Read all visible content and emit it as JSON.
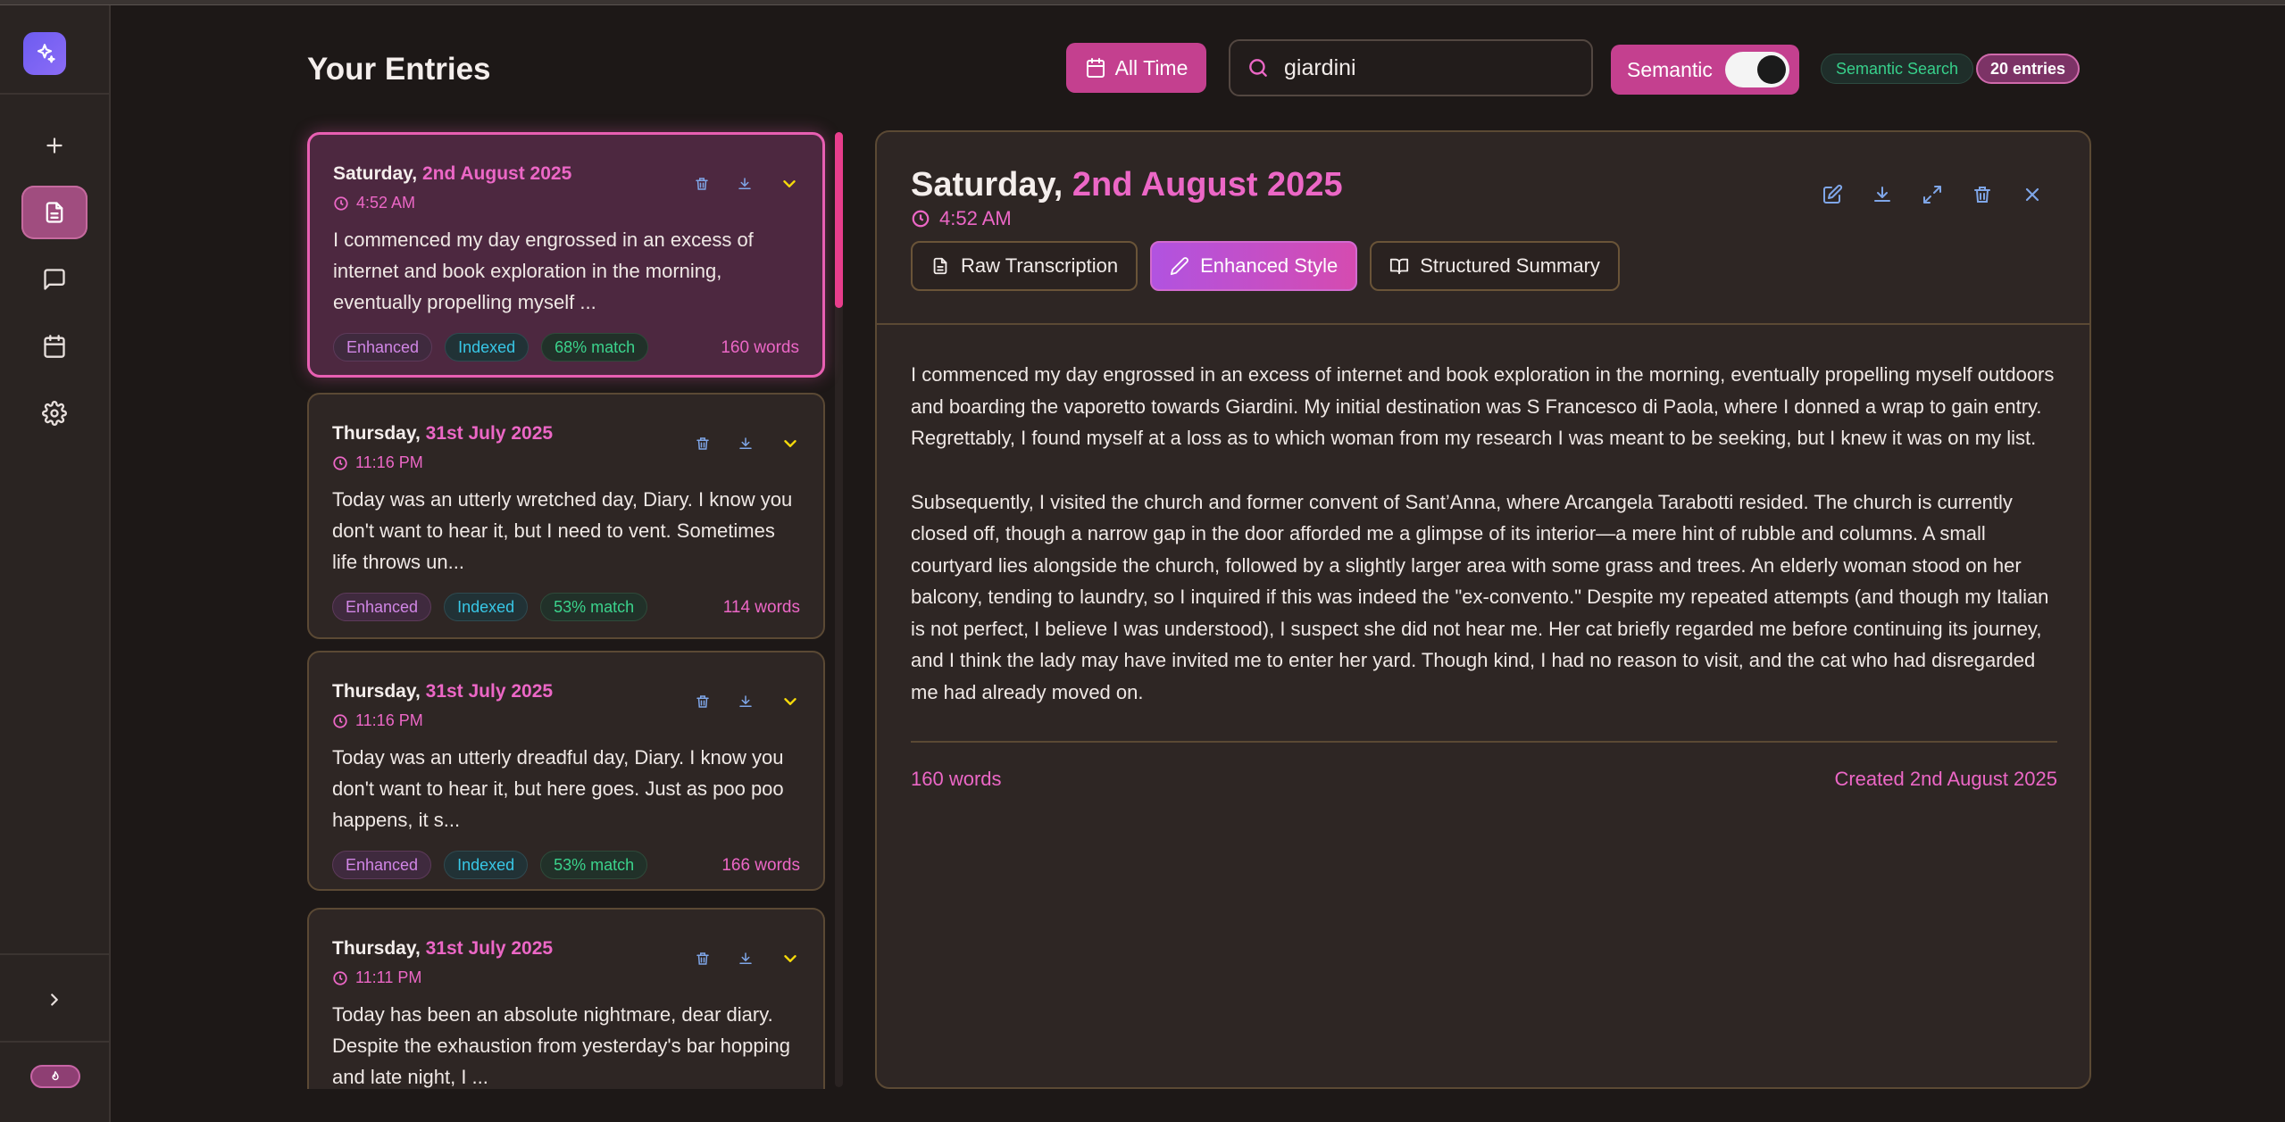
{
  "header": {
    "title": "Your Entries",
    "all_time_label": "All Time",
    "search_value": "giardini",
    "semantic_label": "Semantic",
    "semantic_enabled": true,
    "semantic_badge": "Semantic Search",
    "entries_count": "20 entries"
  },
  "sidebar": {
    "items": [
      {
        "icon": "plus-icon"
      },
      {
        "icon": "document-icon",
        "active": true
      },
      {
        "icon": "chat-icon"
      },
      {
        "icon": "calendar-icon"
      },
      {
        "icon": "gear-icon"
      }
    ],
    "expand_icon": "chevron-right-icon"
  },
  "entries": [
    {
      "weekday": "Saturday,",
      "date": "2nd August 2025",
      "time": "4:52 AM",
      "excerpt": "I commenced my day engrossed in an excess of internet and book exploration in the morning, eventually propelling myself ...",
      "tags": [
        "Enhanced",
        "Indexed",
        "68% match"
      ],
      "words": "160 words",
      "selected": true
    },
    {
      "weekday": "Thursday,",
      "date": "31st July 2025",
      "time": "11:16 PM",
      "excerpt": "Today was an utterly wretched day, Diary. I know you don't want to hear it, but I need to vent. Sometimes life throws un...",
      "tags": [
        "Enhanced",
        "Indexed",
        "53% match"
      ],
      "words": "114 words"
    },
    {
      "weekday": "Thursday,",
      "date": "31st July 2025",
      "time": "11:16 PM",
      "excerpt": "Today was an utterly dreadful day, Diary. I know you don't want to hear it, but here goes. Just as poo poo happens, it s...",
      "tags": [
        "Enhanced",
        "Indexed",
        "53% match"
      ],
      "words": "166 words"
    },
    {
      "weekday": "Thursday,",
      "date": "31st July 2025",
      "time": "11:11 PM",
      "excerpt": "Today has been an absolute nightmare, dear diary. Despite the exhaustion from yesterday's bar hopping and late night, I ...",
      "tags": [],
      "words": ""
    }
  ],
  "detail": {
    "weekday": "Saturday,",
    "date": "2nd August 2025",
    "time": "4:52 AM",
    "modes": [
      "Raw Transcription",
      "Enhanced Style",
      "Structured Summary"
    ],
    "active_mode": "Enhanced Style",
    "paragraphs": [
      "I commenced my day engrossed in an excess of internet and book exploration in the morning, eventually propelling myself outdoors and boarding the vaporetto towards Giardini. My initial destination was S Francesco di Paola, where I donned a wrap to gain entry. Regrettably, I found myself at a loss as to which woman from my research I was meant to be seeking, but I knew it was on my list.",
      "Subsequently, I visited the church and former convent of Sant’Anna, where Arcangela Tarabotti resided. The church is currently closed off, though a narrow gap in the door afforded me a glimpse of its interior—a mere hint of rubble and columns. A small courtyard lies alongside the church, followed by a slightly larger area with some grass and trees. An elderly woman stood on her balcony, tending to laundry, so I inquired if this was indeed the \"ex-convento.\" Despite my repeated attempts (and though my Italian is not perfect, I believe I was understood), I suspect she did not hear me. Her cat briefly regarded me before continuing its journey, and I think the lady may have invited me to enter her yard. Though kind, I had no reason to visit, and the cat who had disregarded me had already moved on."
    ],
    "words": "160 words",
    "created": "Created 2nd August 2025"
  },
  "colors": {
    "accent": "#ec67c6",
    "button": "#c4408f",
    "border": "#5b4934",
    "background": "#1d1817"
  }
}
